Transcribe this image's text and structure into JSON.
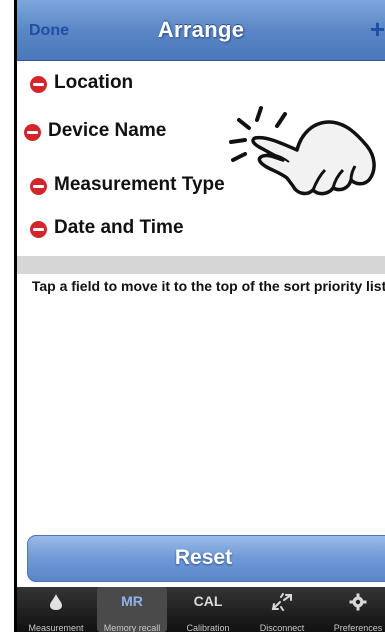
{
  "navbar": {
    "done_label": "Done",
    "title": "Arrange",
    "add_label": "+"
  },
  "fields": [
    {
      "label": "Location"
    },
    {
      "label": "Device Name"
    },
    {
      "label": "Measurement Type"
    },
    {
      "label": "Date and Time"
    }
  ],
  "hint": "Tap a field to move it to the top of the sort priority list.",
  "reset_label": "Reset",
  "tabs": [
    {
      "label": "Measurement",
      "icon": "drop-icon"
    },
    {
      "label": "Memory recall",
      "icon_text": "MR",
      "selected": true
    },
    {
      "label": "Calibration",
      "icon_text": "CAL"
    },
    {
      "label": "Disconnect",
      "icon": "disconnect-arrows-icon"
    },
    {
      "label": "Preferences",
      "icon": "gear-icon"
    }
  ],
  "colors": {
    "nav_blue": "#5b87c7",
    "delete_red": "#d2262a",
    "tabbar_dark": "#1b1b1b"
  }
}
